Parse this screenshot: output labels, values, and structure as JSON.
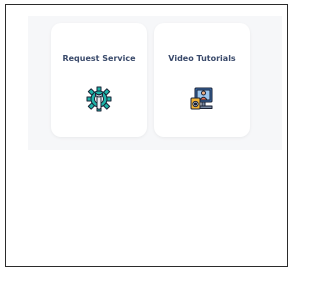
{
  "cards": [
    {
      "label": "Request Service",
      "icon": "gear-wrench-icon",
      "accent": "#1fb3a8"
    },
    {
      "label": "Video Tutorials",
      "icon": "video-tutorial-icon",
      "accent": "#3a6fb0"
    }
  ],
  "colors": {
    "panel_background": "#f6f7f9",
    "card_background": "#ffffff",
    "label_color": "#3a4a6b"
  }
}
